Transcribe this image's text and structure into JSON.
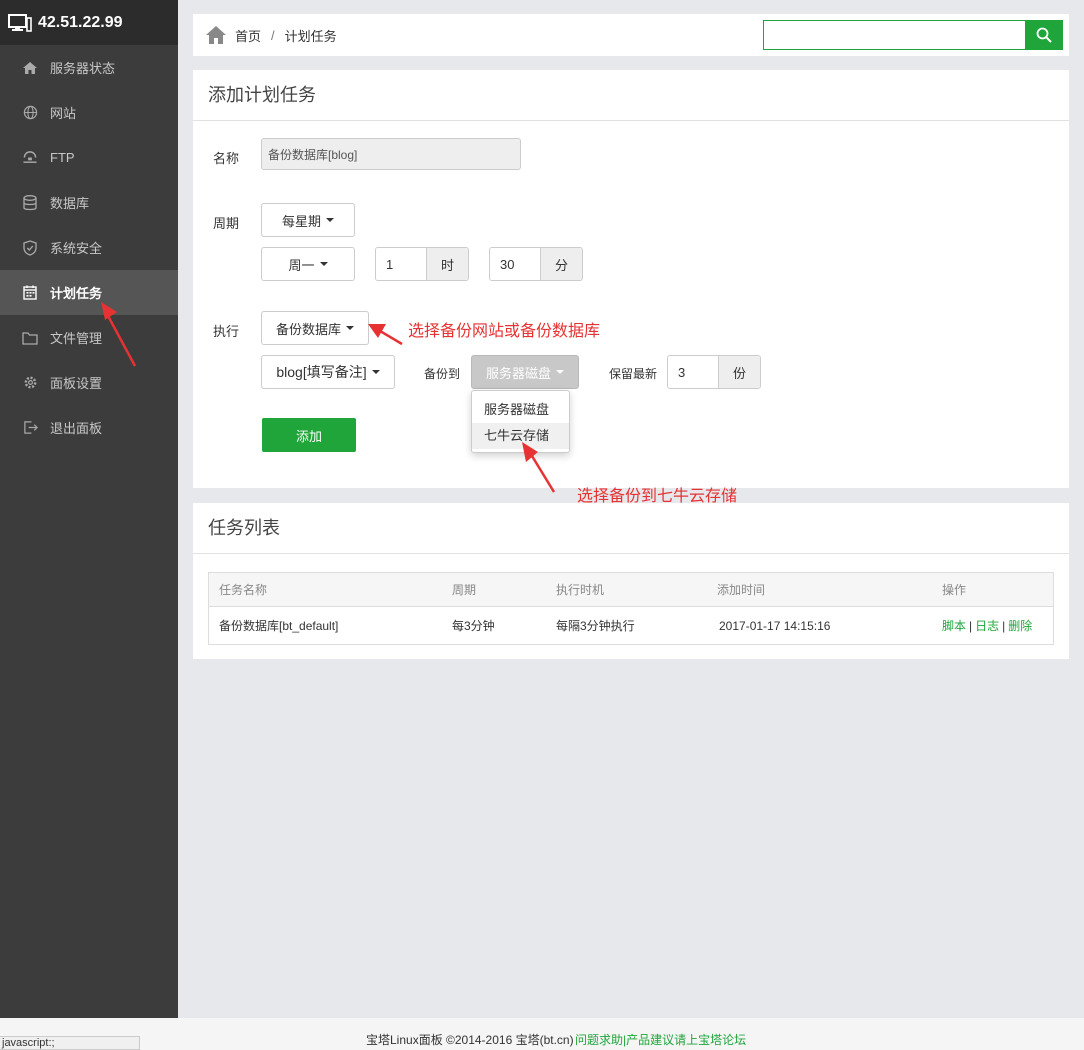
{
  "sidebar": {
    "ip": "42.51.22.99",
    "items": [
      {
        "label": "服务器状态",
        "icon": "home-icon"
      },
      {
        "label": "网站",
        "icon": "globe-icon"
      },
      {
        "label": "FTP",
        "icon": "network-icon"
      },
      {
        "label": "数据库",
        "icon": "database-icon"
      },
      {
        "label": "系统安全",
        "icon": "shield-icon"
      },
      {
        "label": "计划任务",
        "icon": "calendar-icon",
        "active": true
      },
      {
        "label": "文件管理",
        "icon": "folder-icon"
      },
      {
        "label": "面板设置",
        "icon": "gear-icon"
      },
      {
        "label": "退出面板",
        "icon": "logout-icon"
      }
    ]
  },
  "breadcrumb": {
    "home": "首页",
    "separator": "/",
    "current": "计划任务"
  },
  "search": {
    "value": ""
  },
  "add_panel": {
    "title": "添加计划任务",
    "name_label": "名称",
    "name_value": "备份数据库[blog]",
    "period_label": "周期",
    "period_type": "每星期",
    "weekday": "周一",
    "hour_value": "1",
    "hour_unit": "时",
    "minute_value": "30",
    "minute_unit": "分",
    "exec_label": "执行",
    "exec_type": "备份数据库",
    "target": "blog[填写备注]",
    "backup_to_label": "备份到",
    "backup_to_value": "服务器磁盘",
    "keep_label": "保留最新",
    "keep_value": "3",
    "keep_unit": "份",
    "dropdown_options": [
      "服务器磁盘",
      "七牛云存储"
    ],
    "add_button": "添加"
  },
  "annotations": {
    "exec_hint": "选择备份网站或备份数据库",
    "backup_hint": "选择备份到七牛云存储"
  },
  "task_list": {
    "title": "任务列表",
    "columns": [
      "任务名称",
      "周期",
      "执行时机",
      "添加时间",
      "操作"
    ],
    "rows": [
      {
        "name": "备份数据库[bt_default]",
        "period": "每3分钟",
        "timing": "每隔3分钟执行",
        "added": "2017-01-17 14:15:16",
        "actions": [
          "脚本",
          "日志",
          "删除"
        ]
      }
    ]
  },
  "footer": {
    "copyright": "宝塔Linux面板 ©2014-2016 宝塔(bt.cn)",
    "link": "问题求助|产品建议请上宝塔论坛"
  },
  "statusbar": "javascript:;",
  "colors": {
    "accent": "#20a53a",
    "annotation": "#e63232",
    "sidebar": "#3c3c3c"
  }
}
